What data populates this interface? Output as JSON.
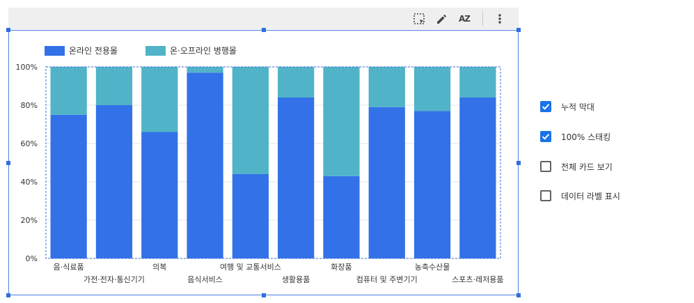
{
  "toolbar": {
    "icons": [
      "select-area-icon",
      "pencil-icon",
      "sort-az-icon",
      "more-vert-icon"
    ],
    "sort_text": "AZ"
  },
  "chart_data": {
    "type": "bar",
    "stacked": true,
    "percent": true,
    "categories": [
      "음·식료품",
      "가전·전자·통신기기",
      "의복",
      "음식서비스",
      "여행 및 교통서비스",
      "생활용품",
      "화장품",
      "컴퓨터 및 주변기기",
      "농축수산물",
      "스포츠·레저용품"
    ],
    "series": [
      {
        "name": "온라인 전용몰",
        "color": "#3271e8",
        "values": [
          75,
          80,
          66,
          97,
          44,
          84,
          43,
          79,
          77,
          84
        ]
      },
      {
        "name": "온·오프라인 병행몰",
        "color": "#50b3c8",
        "values": [
          25,
          20,
          34,
          3,
          56,
          16,
          57,
          21,
          23,
          16
        ]
      }
    ],
    "ylim": [
      0,
      100
    ],
    "yticks": [
      "0%",
      "20%",
      "40%",
      "60%",
      "80%",
      "100%"
    ],
    "grid": true,
    "legend_position": "top-left"
  },
  "options": [
    {
      "label": "누적 막대",
      "checked": true
    },
    {
      "label": "100% 스태킹",
      "checked": true
    },
    {
      "label": "전체 카드 보기",
      "checked": false
    },
    {
      "label": "데이터 라벨 표시",
      "checked": false
    }
  ]
}
